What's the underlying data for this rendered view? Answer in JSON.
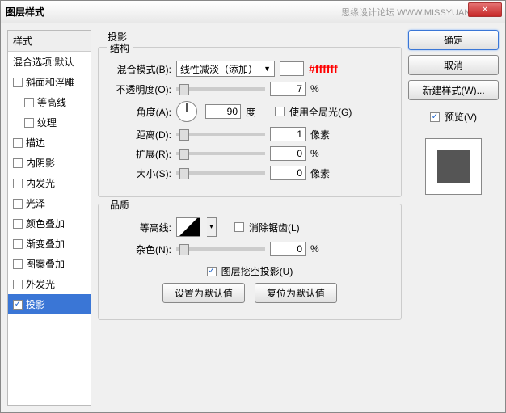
{
  "title": "图层样式",
  "watermark": "思缘设计论坛  WWW.MISSYUAN.COM",
  "close": "×",
  "left": {
    "head": "样式",
    "blend": "混合选项:默认",
    "items": [
      "斜面和浮雕",
      "等高线",
      "纹理",
      "描边",
      "内阴影",
      "内发光",
      "光泽",
      "颜色叠加",
      "渐变叠加",
      "图案叠加",
      "外发光",
      "投影"
    ]
  },
  "panel_title": "投影",
  "structure": {
    "legend": "结构",
    "blend_lbl": "混合模式(B):",
    "blend_val": "线性减淡（添加）",
    "hex": "#ffffff",
    "opacity_lbl": "不透明度(O):",
    "opacity_val": "7",
    "pct": "%",
    "angle_lbl": "角度(A):",
    "angle_val": "90",
    "deg": "度",
    "global_lbl": "使用全局光(G)",
    "dist_lbl": "距离(D):",
    "dist_val": "1",
    "px": "像素",
    "spread_lbl": "扩展(R):",
    "spread_val": "0",
    "size_lbl": "大小(S):",
    "size_val": "0"
  },
  "quality": {
    "legend": "品质",
    "contour_lbl": "等高线:",
    "aa_lbl": "消除锯齿(L)",
    "noise_lbl": "杂色(N):",
    "noise_val": "0",
    "knockout_lbl": "图层挖空投影(U)",
    "default_btn": "设置为默认值",
    "reset_btn": "复位为默认值"
  },
  "right": {
    "ok": "确定",
    "cancel": "取消",
    "newstyle": "新建样式(W)...",
    "preview_lbl": "预览(V)"
  }
}
